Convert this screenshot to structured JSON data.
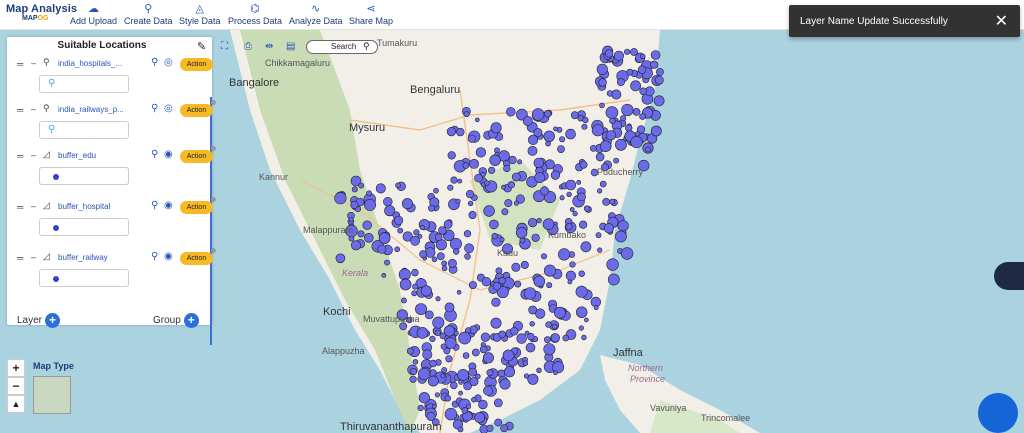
{
  "app": {
    "title": "Map Analysis",
    "brand_main": "MAP",
    "brand_accent": "OG"
  },
  "nav": [
    {
      "label": "Add Upload",
      "icon": "cloud-upload-icon"
    },
    {
      "label": "Create Data",
      "icon": "map-pin-icon"
    },
    {
      "label": "Style Data",
      "icon": "paint-bucket-icon"
    },
    {
      "label": "Process Data",
      "icon": "process-icon"
    },
    {
      "label": "Analyze Data",
      "icon": "chart-icon"
    },
    {
      "label": "Share Map",
      "icon": "share-icon"
    }
  ],
  "toast": {
    "message": "Layer Name Update Successfully",
    "close": "✕"
  },
  "panel": {
    "title": "Suitable Locations",
    "layers": [
      {
        "name": "india_hospitals_...",
        "type_icon": "point-icon",
        "visibility": "hidden",
        "action": "Action",
        "legend": "pin"
      },
      {
        "name": "india_railways_p...",
        "type_icon": "point-icon",
        "visibility": "hidden",
        "action": "Action",
        "legend": "pin"
      },
      {
        "name": "buffer_edu",
        "type_icon": "polygon-icon",
        "visibility": "visible",
        "action": "Action",
        "legend": "fill"
      },
      {
        "name": "buffer_hospital",
        "type_icon": "polygon-icon",
        "visibility": "visible",
        "action": "Action",
        "legend": "fill"
      },
      {
        "name": "buffer_railway",
        "type_icon": "polygon-icon",
        "visibility": "visible",
        "action": "Action",
        "legend": "fill"
      }
    ],
    "footer_layer": "Layer",
    "footer_group": "Group"
  },
  "search": {
    "placeholder": "Search"
  },
  "zoom": {
    "in": "+",
    "out": "−"
  },
  "map_type": {
    "label": "Map Type"
  },
  "places": [
    {
      "name": "Bangalore",
      "cls": "big"
    },
    {
      "name": "Bengaluru",
      "cls": "big"
    },
    {
      "name": "Tumakuru",
      "cls": ""
    },
    {
      "name": "Chikkamagaluru",
      "cls": ""
    },
    {
      "name": "Mysuru",
      "cls": "big"
    },
    {
      "name": "Kannur",
      "cls": ""
    },
    {
      "name": "Malappuram",
      "cls": ""
    },
    {
      "name": "Kerala",
      "cls": "state"
    },
    {
      "name": "Kochi",
      "cls": "big"
    },
    {
      "name": "Muvattupuzha",
      "cls": ""
    },
    {
      "name": "Alappuzha",
      "cls": ""
    },
    {
      "name": "Thiruvananthapuram",
      "cls": "big"
    },
    {
      "name": "Jaffna",
      "cls": "big"
    },
    {
      "name": "Northern",
      "cls": "state"
    },
    {
      "name": "Province",
      "cls": "state"
    },
    {
      "name": "Vavuniya",
      "cls": ""
    },
    {
      "name": "Trincomalee",
      "cls": ""
    },
    {
      "name": "Puducherry",
      "cls": ""
    },
    {
      "name": "Kumbako",
      "cls": ""
    },
    {
      "name": "Kadu",
      "cls": ""
    }
  ],
  "colors": {
    "accent": "#2a54b8",
    "action": "#f7b924",
    "buffer_fill": "#6b6bea",
    "toast_bg": "#323232"
  }
}
